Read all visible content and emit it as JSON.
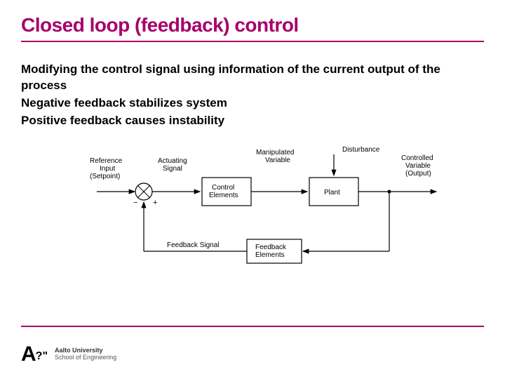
{
  "title": "Closed loop (feedback) control",
  "bullets": [
    "Modifying the control signal using information of the current output of the process",
    "Negative feedback stabilizes system",
    "Positive feedback causes instability"
  ],
  "diagram": {
    "labels": {
      "reference": "Reference\nInput\n(Setpoint)",
      "actuating": "Actuating\nSignal",
      "manipulated": "Manipulated\nVariable",
      "disturbance": "Disturbance",
      "controlled": "Controlled\nVariable\n(Output)",
      "control_elements": "Control\nElements",
      "plant": "Plant",
      "feedback_signal": "Feedback Signal",
      "feedback_elements": "Feedback\nElements",
      "minus": "−",
      "plus": "+"
    }
  },
  "footer": {
    "logo_letter": "A",
    "logo_marks": "?\"",
    "org_line1": "Aalto University",
    "org_line2": "School of Engineering"
  },
  "colors": {
    "accent": "#a6006b"
  }
}
